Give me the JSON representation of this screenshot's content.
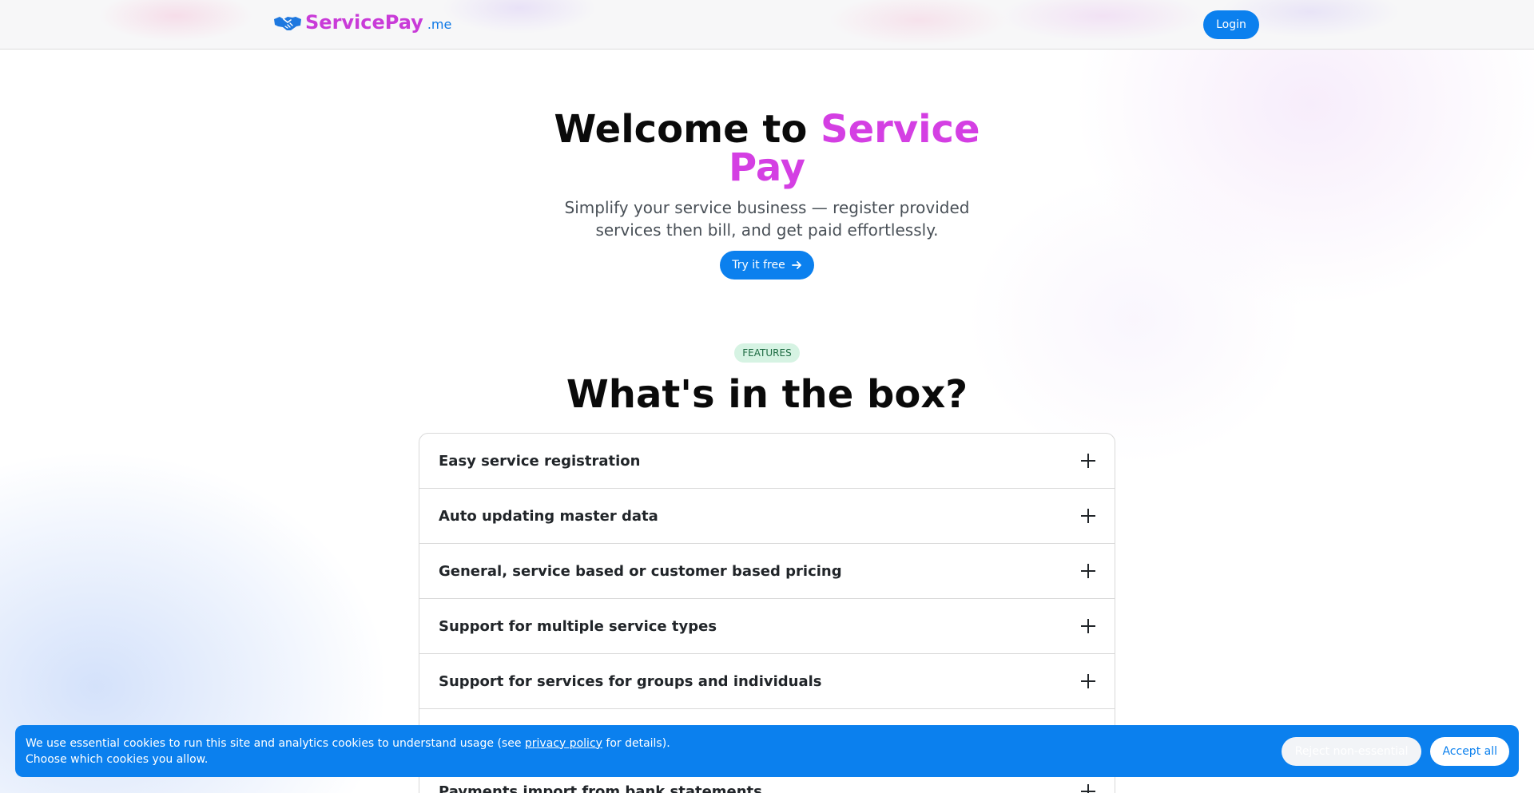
{
  "header": {
    "brand_name": "ServicePay",
    "brand_tld": ".me",
    "logo_icon": "handshake-icon",
    "login_label": "Login"
  },
  "hero": {
    "title_prefix": "Welcome to",
    "title_accent": "Service Pay",
    "subtitle": "Simplify your service business — register provided services then bill, and get paid effortlessly.",
    "cta_label": "Try it free",
    "cta_icon": "arrow-right-icon"
  },
  "features": {
    "badge": "FEATURES",
    "heading": "What's in the box?",
    "items": [
      {
        "label": "Easy service registration"
      },
      {
        "label": "Auto updating master data"
      },
      {
        "label": "General, service based or customer based pricing"
      },
      {
        "label": "Support for multiple service types"
      },
      {
        "label": "Support for services for groups and individuals"
      },
      {
        "label": ""
      },
      {
        "label": "Payments import from bank statements"
      }
    ],
    "item_icon": "plus-icon"
  },
  "cookie_banner": {
    "text_before_link": "We use essential cookies to run this site and analytics cookies to understand usage (see ",
    "link_label": "privacy policy",
    "text_after_link": " for details).",
    "line2": "Choose which cookies you allow.",
    "reject_label": "Reject non-essential",
    "accept_label": "Accept all"
  },
  "colors": {
    "primary": "#0b80ee",
    "brand_accent": "#d43fe3",
    "badge_bg": "#d6f3e3",
    "badge_text": "#1d6b42"
  }
}
